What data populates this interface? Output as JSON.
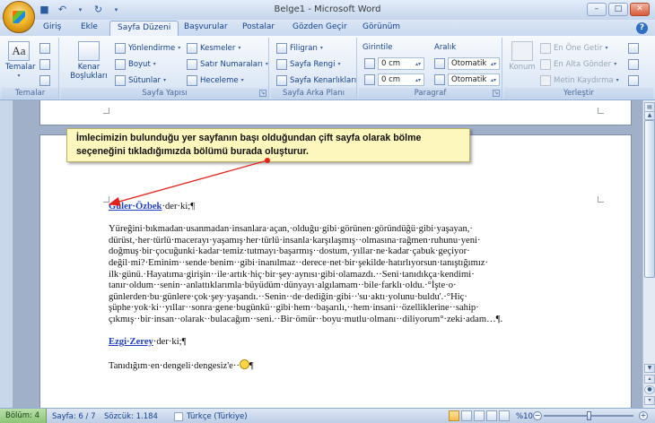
{
  "window": {
    "title": "Belge1 - Microsoft Word",
    "controls": [
      "–",
      "□",
      "✕"
    ]
  },
  "quick_access": [
    {
      "name": "save-icon",
      "glyph": "💾"
    },
    {
      "name": "undo-icon",
      "glyph": "↶"
    },
    {
      "name": "redo-icon",
      "glyph": "↷"
    },
    {
      "name": "qat-menu-icon",
      "glyph": "▾"
    }
  ],
  "tabs": [
    "Giriş",
    "Ekle",
    "Sayfa Düzeni",
    "Başvurular",
    "Postalar",
    "Gözden Geçir",
    "Görünüm"
  ],
  "active_tab": "Sayfa Düzeni",
  "ribbon": {
    "temalar": {
      "button": "Temalar",
      "group_label": "Temalar"
    },
    "sayfa_yapisi": {
      "kenar": "Kenar Boşlukları",
      "yonlendirme": "Yönlendirme",
      "boyut": "Boyut",
      "sutunlar": "Sütunlar",
      "kesmeler": "Kesmeler",
      "satir_numaralari": "Satır Numaraları",
      "heceleme": "Heceleme",
      "group_label": "Sayfa Yapısı"
    },
    "sayfa_arka_plani": {
      "filigran": "Filigran",
      "sayfa_rengi": "Sayfa Rengi",
      "sayfa_kenarliklari": "Sayfa Kenarlıkları",
      "group_label": "Sayfa Arka Planı"
    },
    "paragraf": {
      "girinti": "Girintile",
      "girinti_sol": "0 cm",
      "girinti_sag": "0 cm",
      "aralik": "Aralık",
      "aralik_once": "Otomatik",
      "aralik_sonra": "Otomatik",
      "group_label": "Paragraf"
    },
    "yerlestir": {
      "konum": "Konum",
      "en_one": "En Öne Getir",
      "en_alta": "En Alta Gönder",
      "metin_kaydirma": "Metin Kaydırma",
      "group_label": "Yerleştir"
    }
  },
  "callout": {
    "text": "İmlecimizin bulunduğu yer sayfanın başı olduğundan çift sayfa olarak bölme seçeneğini tıkladığımızda bölümü burada oluşturur."
  },
  "document": {
    "para1_name": "Güler·Özbek",
    "para1_rest": "·der·ki;¶",
    "para2_lines": [
      "Yüreğini·bıkmadan·usanmadan·insanlara·açan,·olduğu·gibi·görünen·göründüğü·gibi·yaşayan,·",
      "dürüst,·her·türlü·macerayı·yaşamış·her·türlü·insanla·karşılaşmış··olmasına·rağmen·ruhunu·yeni·",
      "doğmuş·bir·çocuğunki·kadar·temiz·tutmayı·başarmış··dostum,·yıllar·ne·kadar·çabuk·geçiyor·",
      "değil·mi?·Eminim··sende·benim··gibi·inanılmaz··derece·net·bir·şekilde·hatırlıyorsun·tanıştığımız·",
      "ilk·günü.·Hayatıma·girişin··ile·artık·hiç·bir·şey·aynısı·gibi·olamazdı.··Seni·tanıdıkça·kendimi·",
      "tanır·oldum··senin··anlattıklarımla·büyüdüm·dünyayı·algılamam··bile·farklı·oldu.·°İşte·o·",
      "günlerden·bu·günlere·çok·şey·yaşandı.··Senin··de·dediğin·gibi··'su·aktı·yolunu·buldu'.·°Hiç·",
      "şüphe·yok·ki··yıllar··sonra·gene·bugünkü··gibi·hem··başarılı,··hem·insani··özelliklerine··sahip·",
      "çıkmış··bir·insan··olarak··bulacağım··seni.··Bir·ömür··boyu·mutlu·olmanı··diliyorum°·zeki·adam…¶."
    ],
    "para3_name": "Ezgi·Zerey",
    "para3_rest": "·der·ki;¶",
    "para4": "Tanıdığım·en·dengeli·dengesiz'e··",
    "para4_end": "¶"
  },
  "status": {
    "section": "Bölüm: 4",
    "page": "Sayfa: 6 / 7",
    "words": "Sözcük: 1.184",
    "language": "Türkçe (Türkiye)",
    "zoom": "%100",
    "zoom_minus": "−",
    "zoom_plus": "+"
  },
  "colors": {
    "callout_bg": "#fdf6bd",
    "arrow": "#e0241b",
    "name_link": "#1f3fbf",
    "section_status": "#8cc57a"
  }
}
